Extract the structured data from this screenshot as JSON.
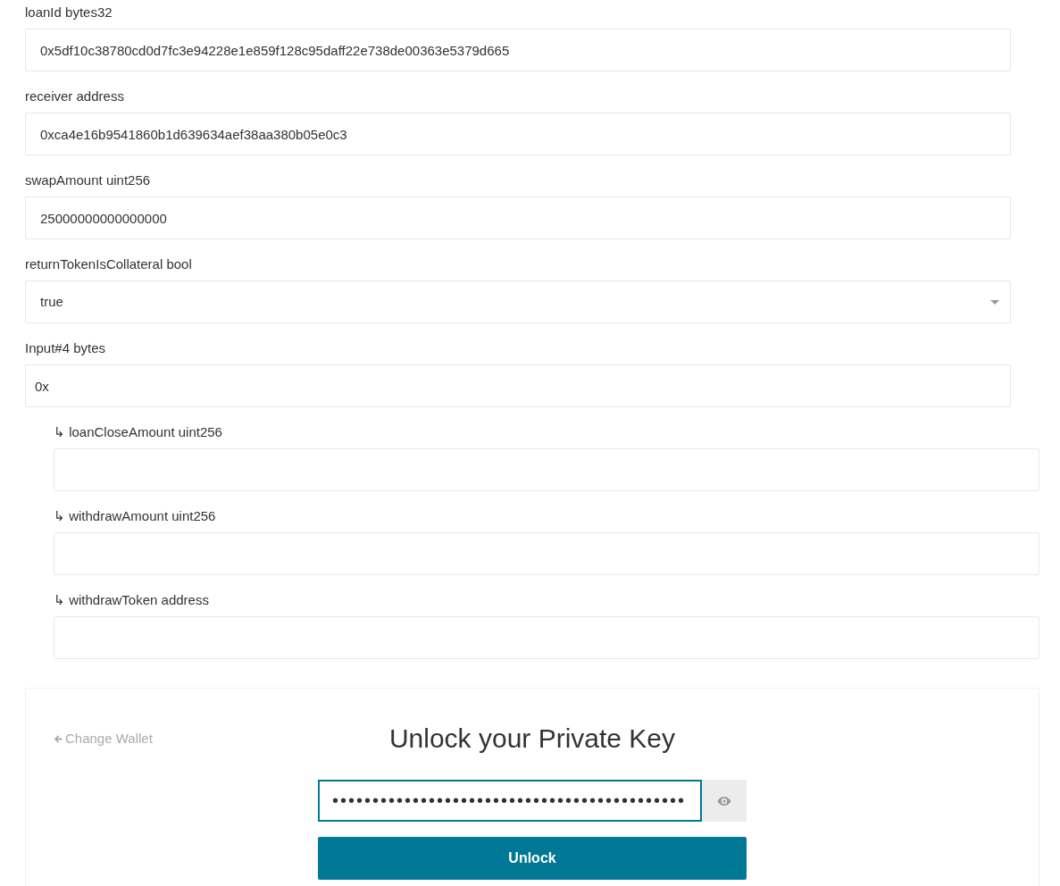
{
  "inputs": [
    {
      "kind": "text",
      "label": "loanId bytes32",
      "value": "0x5df10c38780cd0d7fc3e94228e1e859f128c95daff22e738de00363e5379d665"
    },
    {
      "kind": "text",
      "label": "receiver address",
      "value": "0xca4e16b9541860b1d639634aef38aa380b05e0c3"
    },
    {
      "kind": "text",
      "label": "swapAmount uint256",
      "value": "25000000000000000"
    },
    {
      "kind": "select",
      "label": "returnTokenIsCollateral bool",
      "value": "true"
    },
    {
      "kind": "text",
      "label": "Input#4 bytes",
      "value": "0x",
      "children": [
        {
          "kind": "text",
          "marker": "↳",
          "label": "loanCloseAmount uint256"
        },
        {
          "kind": "text",
          "marker": "↳",
          "label": "withdrawAmount uint256"
        },
        {
          "kind": "text",
          "marker": "↳",
          "label": "withdrawToken address"
        }
      ]
    }
  ],
  "unlock": {
    "back_link": "Change Wallet",
    "title": "Unlock your Private Key",
    "password": "••••••••••••••••••••••••••••••••••••••••••••",
    "button": "Unlock"
  }
}
